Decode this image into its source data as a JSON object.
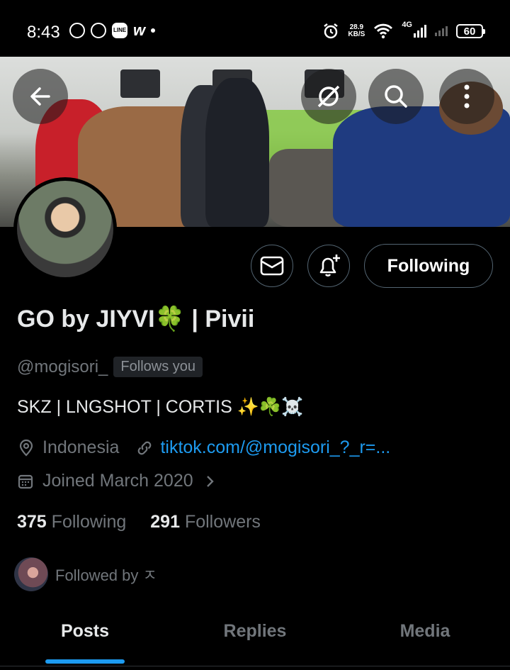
{
  "status_bar": {
    "time": "8:43",
    "net_speed_value": "28.9",
    "net_speed_unit": "KB/S",
    "network": "4G",
    "battery": "60",
    "line_label": "LINE"
  },
  "header": {
    "back_icon": "arrow-left-icon",
    "grok_icon": "grok-icon",
    "search_icon": "search-icon",
    "more_icon": "more-vertical-icon"
  },
  "profile": {
    "display_name": "GO by JIYVI🍀 | Pivii",
    "handle": "@mogisori_",
    "follows_you": "Follows you",
    "bio": "SKZ | LNGSHOT | CORTIS ✨☘️☠️",
    "location": "Indonesia",
    "website": "tiktok.com/@mogisori_?_r=...",
    "joined": "Joined March 2020",
    "following_count": "375",
    "following_label": "Following",
    "followers_count": "291",
    "followers_label": "Followers",
    "followed_by": "Followed by ㅈ"
  },
  "actions": {
    "follow_state": "Following",
    "message_icon": "envelope-icon",
    "notify_icon": "bell-plus-icon"
  },
  "tabs": [
    {
      "label": "Posts"
    },
    {
      "label": "Replies"
    },
    {
      "label": "Media"
    }
  ],
  "colors": {
    "accent": "#1d9bf0",
    "background": "#000000",
    "muted_text": "#71767b",
    "primary_text": "#e7e9ea"
  }
}
